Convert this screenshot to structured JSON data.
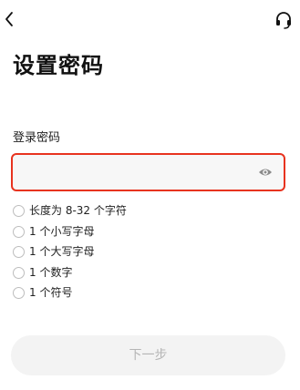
{
  "header": {
    "back_icon": "chevron-left-icon",
    "support_icon": "headset-icon"
  },
  "page": {
    "title": "设置密码"
  },
  "form": {
    "password_label": "登录密码",
    "password_value": "",
    "password_placeholder": "",
    "toggle_icon": "eye-icon",
    "input_border_color": "#e8331f"
  },
  "rules": [
    {
      "text": "长度为 8-32 个字符",
      "checked": false
    },
    {
      "text": "1 个小写字母",
      "checked": false
    },
    {
      "text": "1 个大写字母",
      "checked": false
    },
    {
      "text": "1 个数字",
      "checked": false
    },
    {
      "text": "1 个符号",
      "checked": false
    }
  ],
  "footer": {
    "next_label": "下一步",
    "next_enabled": false
  }
}
